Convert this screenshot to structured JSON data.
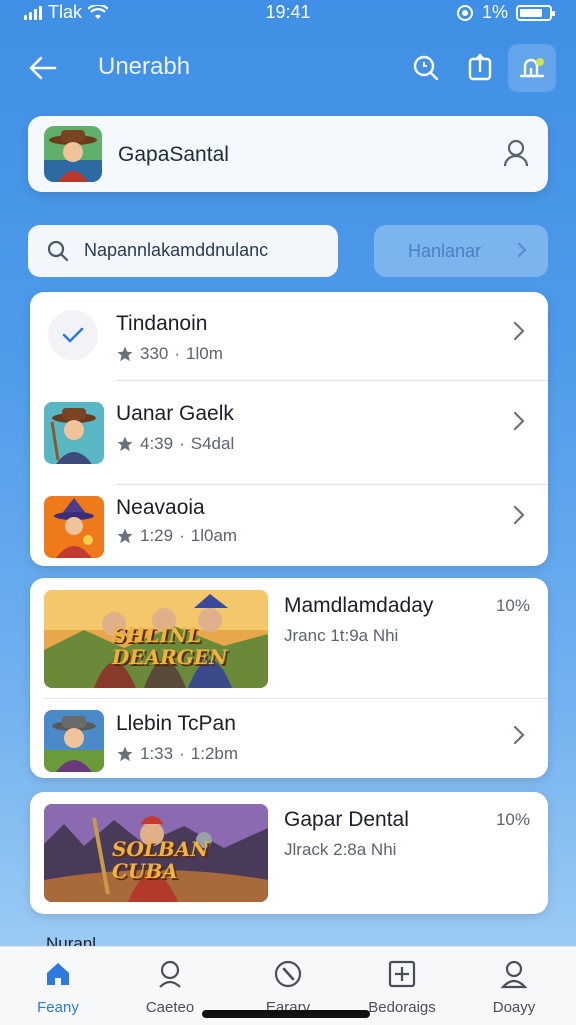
{
  "status_bar": {
    "carrier": "Tlak",
    "time": "19:41",
    "battery": "1%"
  },
  "header": {
    "title": "Unerabh"
  },
  "profile": {
    "name": "GapaSantal"
  },
  "search": {
    "query": "Napannlakamddnulanc"
  },
  "filter": {
    "label": "Hanlanar"
  },
  "list_items": [
    {
      "name": "Tindanoin",
      "rating": "330",
      "detail": "1l0m"
    },
    {
      "name": "Uanar Gaelk",
      "rating": "4:39",
      "detail": "S4dal"
    },
    {
      "name": "Neavaoia",
      "rating": "1:29",
      "detail": "1l0am"
    }
  ],
  "featured": [
    {
      "title": "Mamdlamdaday",
      "subtitle": "Jranc 1t:9a Nhi",
      "percent": "10%",
      "banner_text": "SHLINL DEARGEN"
    },
    {
      "title": "Gapar Dental",
      "subtitle": "Jlrack 2:8a Nhi",
      "percent": "10%",
      "banner_text": "SOLBAN CUBA"
    }
  ],
  "mid_item": {
    "name": "Llebin TcPan",
    "rating": "1:33",
    "detail": "1:2bm"
  },
  "section_label": "Nuranl",
  "tabs": [
    {
      "label": "Feany",
      "icon": "home-icon"
    },
    {
      "label": "Caeteo",
      "icon": "person-icon"
    },
    {
      "label": "Eararv",
      "icon": "compass-icon"
    },
    {
      "label": "Bedoraigs",
      "icon": "plus-box-icon"
    },
    {
      "label": "Doayy",
      "icon": "profile-icon"
    }
  ],
  "colors": {
    "accent": "#2d7ae0",
    "background_top": "#3f8fe6",
    "card": "#ffffff"
  }
}
